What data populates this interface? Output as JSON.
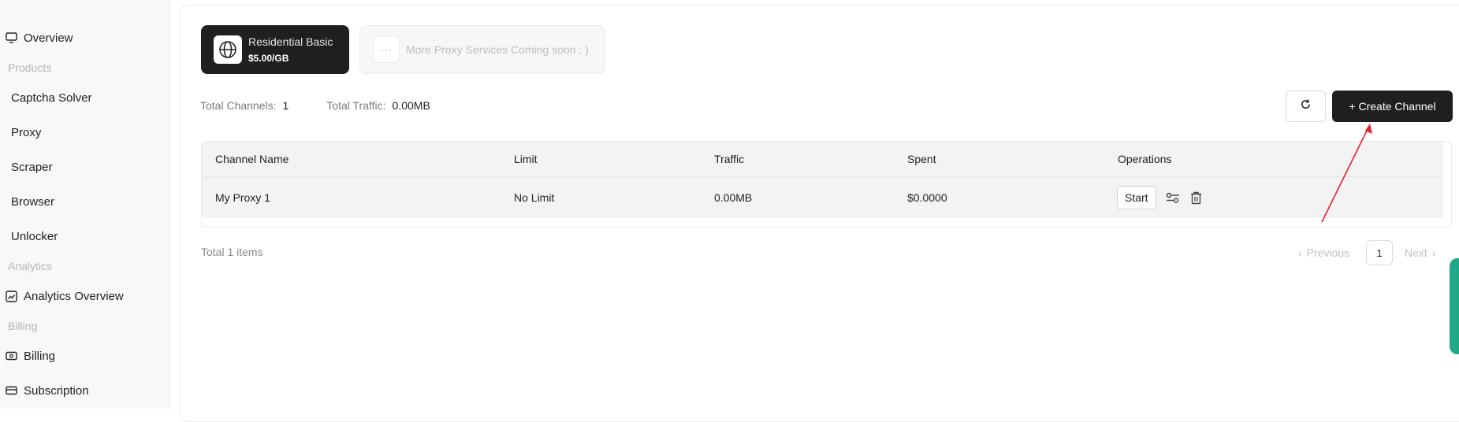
{
  "sidebar": {
    "overview": "Overview",
    "group_products": "Products",
    "captcha": "Captcha Solver",
    "proxy": "Proxy",
    "scraper": "Scraper",
    "browser": "Browser",
    "unlocker": "Unlocker",
    "group_analytics": "Analytics",
    "analytics_overview": "Analytics Overview",
    "group_billing": "Billing",
    "billing": "Billing",
    "subscription": "Subscription"
  },
  "services": {
    "active": {
      "name": "Residential Basic",
      "price": "$5.00/GB"
    },
    "coming": {
      "name": "More Proxy Services Coming soon : )"
    }
  },
  "stats": {
    "channels_label": "Total Channels:",
    "channels_value": "1",
    "traffic_label": "Total Traffic:",
    "traffic_value": "0.00MB"
  },
  "toolbar": {
    "create_label": "+ Create Channel"
  },
  "table": {
    "columns": [
      "Channel Name",
      "Limit",
      "Traffic",
      "Spent",
      "Operations"
    ],
    "rows": [
      {
        "name": "My Proxy 1",
        "limit": "No Limit",
        "traffic": "0.00MB",
        "spent": "$0.0000",
        "start_label": "Start"
      }
    ]
  },
  "pagination": {
    "total_text": "Total 1 items",
    "previous": "Previous",
    "current_page": "1",
    "next": "Next"
  },
  "colors": {
    "primary": "#1f1f1f",
    "accent_tab": "#1fa987",
    "annotation_arrow": "#e8202a"
  }
}
